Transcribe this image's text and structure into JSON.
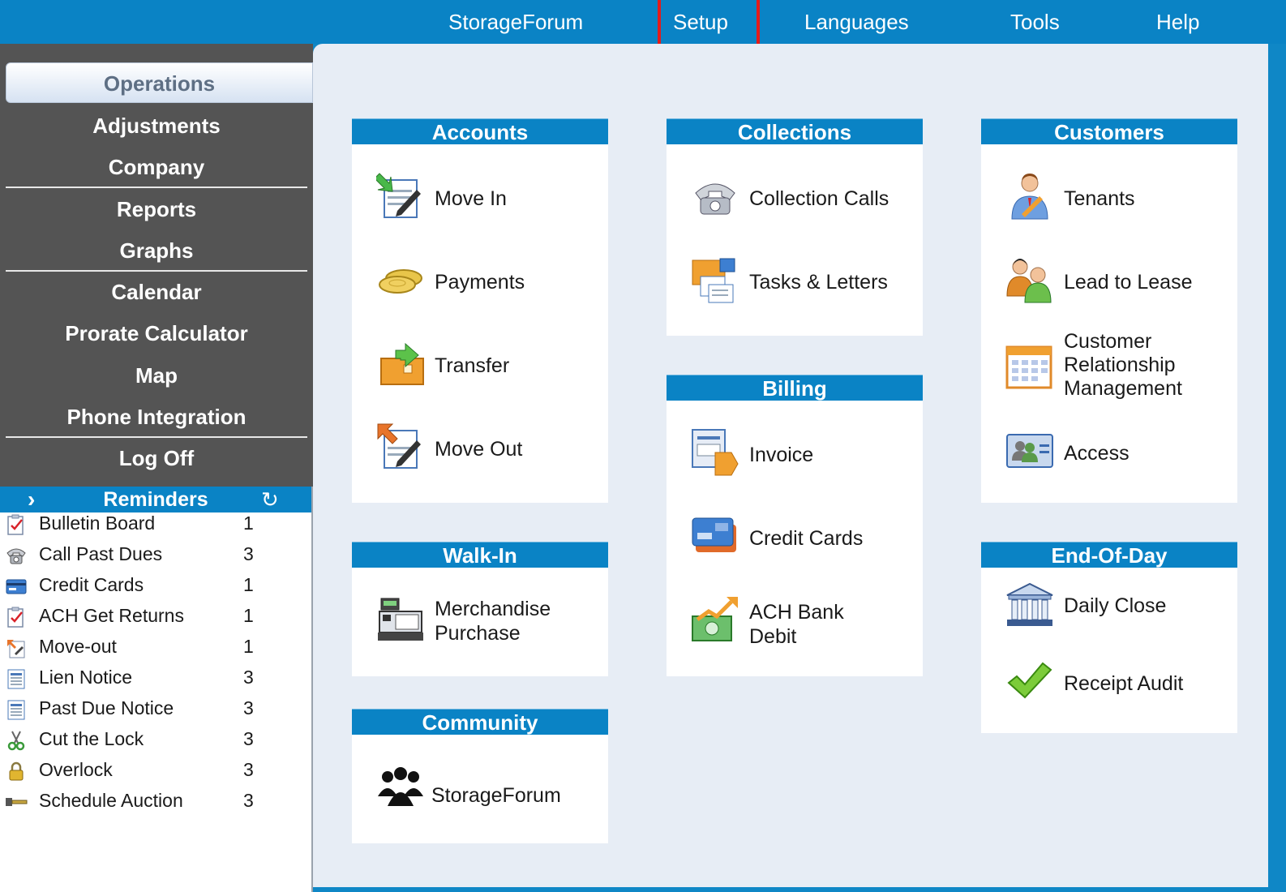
{
  "menu": {
    "storageforum": "StorageForum",
    "setup": "Setup",
    "languages": "Languages",
    "tools": "Tools",
    "help": "Help"
  },
  "nav": {
    "operations": "Operations",
    "adjustments": "Adjustments",
    "company": "Company",
    "reports": "Reports",
    "graphs": "Graphs",
    "calendar": "Calendar",
    "prorate": "Prorate Calculator",
    "map": "Map",
    "phone": "Phone Integration",
    "logoff": "Log Off"
  },
  "reminders": {
    "title": "Reminders",
    "items": [
      {
        "label": "Bulletin Board",
        "count": "1",
        "icon": "clipboard-check-icon"
      },
      {
        "label": "Call Past Dues",
        "count": "3",
        "icon": "telephone-icon"
      },
      {
        "label": "Credit Cards",
        "count": "1",
        "icon": "credit-card-icon"
      },
      {
        "label": "ACH Get Returns",
        "count": "1",
        "icon": "clipboard-check-icon"
      },
      {
        "label": "Move-out",
        "count": "1",
        "icon": "move-out-icon"
      },
      {
        "label": "Lien Notice",
        "count": "3",
        "icon": "document-icon"
      },
      {
        "label": "Past Due Notice",
        "count": "3",
        "icon": "document-icon"
      },
      {
        "label": "Cut the Lock",
        "count": "3",
        "icon": "scissors-icon"
      },
      {
        "label": "Overlock",
        "count": "3",
        "icon": "padlock-icon"
      },
      {
        "label": "Schedule Auction",
        "count": "3",
        "icon": "gavel-icon"
      }
    ]
  },
  "panels": {
    "accounts": {
      "title": "Accounts",
      "move_in": "Move In",
      "payments": "Payments",
      "transfer": "Transfer",
      "move_out": "Move Out"
    },
    "walkin": {
      "title": "Walk-In",
      "merch1": "Merchandise",
      "merch2": "Purchase"
    },
    "community": {
      "title": "Community",
      "storageforum": "StorageForum"
    },
    "collections": {
      "title": "Collections",
      "calls": "Collection Calls",
      "tasks": "Tasks & Letters"
    },
    "billing": {
      "title": "Billing",
      "invoice": "Invoice",
      "credit_cards": "Credit Cards",
      "ach1": "ACH Bank",
      "ach2": "Debit"
    },
    "customers": {
      "title": "Customers",
      "tenants": "Tenants",
      "lead": "Lead to Lease",
      "crm1": "Customer",
      "crm2": "Relationship",
      "crm3": "Management",
      "access": "Access"
    },
    "eod": {
      "title": "End-Of-Day",
      "daily_close": "Daily Close",
      "receipt_audit": "Receipt Audit"
    }
  }
}
